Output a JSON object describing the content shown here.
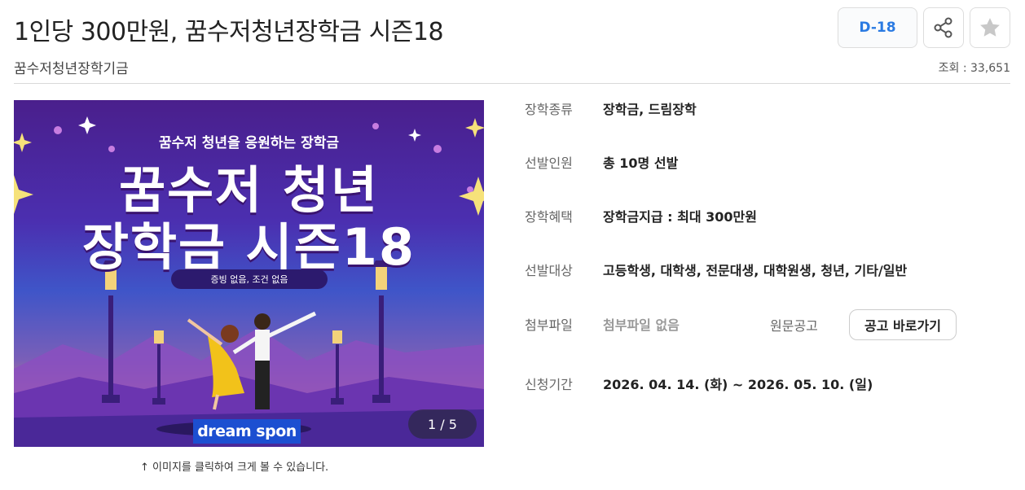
{
  "header": {
    "title": "1인당 300만원, 꿈수저청년장학금 시즌18",
    "organization": "꿈수저청년장학기금",
    "views": "조회 : 33,651",
    "dday": "D-18",
    "icons": {
      "share": "share-icon",
      "favorite": "star-icon"
    }
  },
  "poster": {
    "subtitle": "꿈수저 청년을 응원하는 장학금",
    "title_line1": "꿈수저 청년",
    "title_line2": "장학금 시즌18",
    "pill": "증빙 없음, 조건 없음",
    "brand": "dream spon",
    "pager": "1 / 5",
    "colors": {
      "sky_top": "#4a1f8c",
      "sky_mid": "#3f55c8",
      "sunset": "#e89a76",
      "dress": "#f2c21a",
      "lamp": "#3a1e7a"
    }
  },
  "caption": "↑ 이미지를 클릭하여 크게 볼 수 있습니다.",
  "details": [
    {
      "label": "장학종류",
      "value": "장학금, 드림장학"
    },
    {
      "label": "선발인원",
      "value": "총 10명 선발"
    },
    {
      "label": "장학혜택",
      "value": "장학금지급 : 최대 300만원"
    },
    {
      "label": "선발대상",
      "value": "고등학생, 대학생, 전문대생, 대학원생, 청년, 기타/일반"
    },
    {
      "label": "첨부파일",
      "value": "첨부파일 없음"
    },
    {
      "label": "신청기간",
      "value": "2026. 04. 14. (화) ~ 2026. 05. 10. (일)"
    }
  ],
  "original": {
    "label": "원문공고",
    "button": "공고 바로가기"
  },
  "accent": "#2a7ae2"
}
